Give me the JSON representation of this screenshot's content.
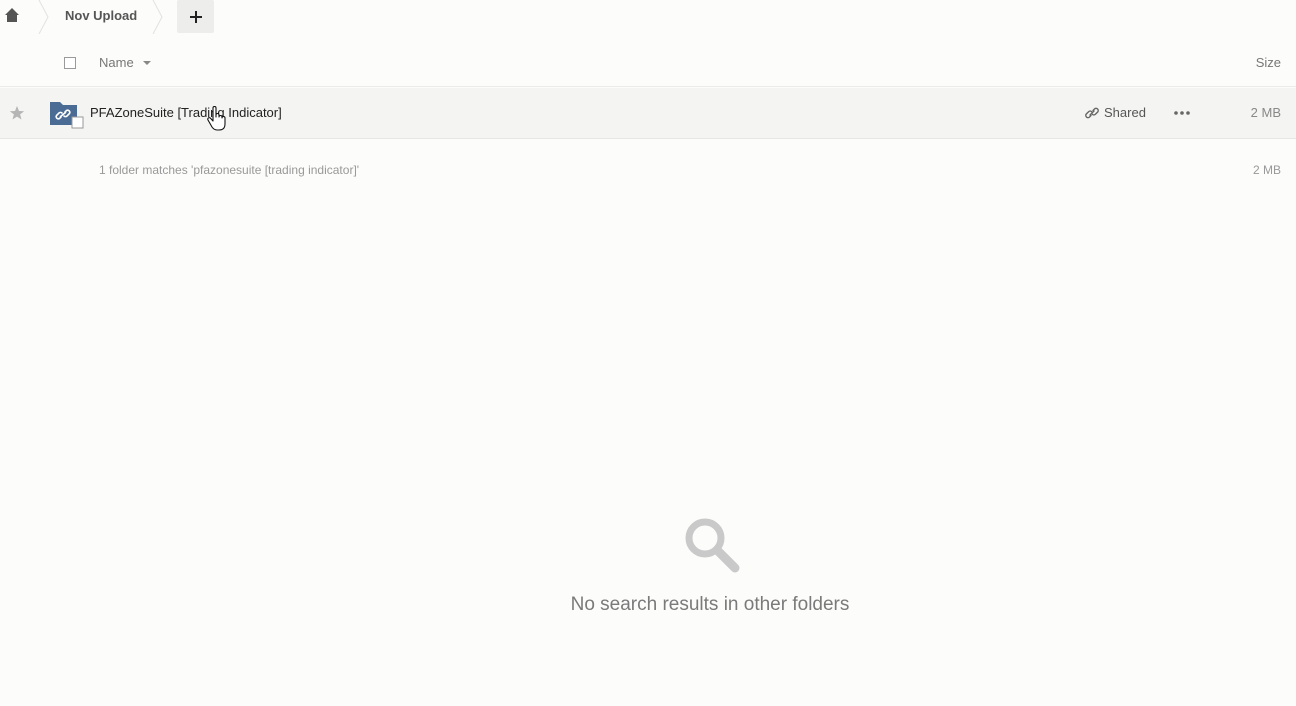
{
  "breadcrumb": {
    "home_icon": "home-icon",
    "current_folder": "Nov Upload",
    "new_button_icon": "plus-icon"
  },
  "table_header": {
    "name_label": "Name",
    "size_label": "Size"
  },
  "files": [
    {
      "name": "PFAZoneSuite [Trading Indicator]",
      "type_icon": "shared-folder-icon",
      "shared_label": "Shared",
      "size": "2 MB"
    }
  ],
  "summary": {
    "text": "1 folder matches 'pfazonesuite [trading indicator]'",
    "size": "2 MB"
  },
  "empty_state": {
    "icon": "search-icon",
    "text": "No search results in other folders"
  },
  "colors": {
    "folder": "#4a6b94",
    "background": "#fcfcfa",
    "row_highlight": "#f4f4f2"
  }
}
